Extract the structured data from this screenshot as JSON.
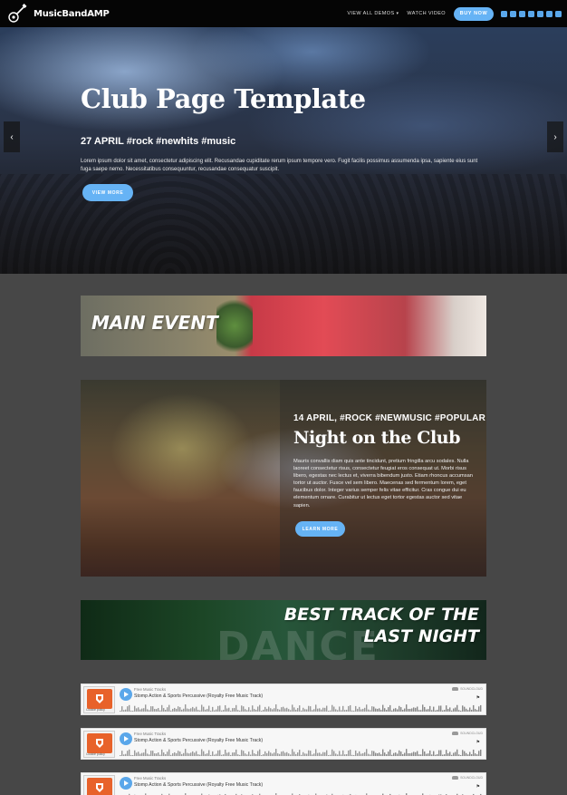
{
  "nav": {
    "brand": "MusicBandAMP",
    "demos_label": "VIEW ALL DEMOS",
    "video_label": "WATCH VIDEO",
    "buy_label": "BUY NOW"
  },
  "social_icons": [
    "youtube-icon",
    "facebook-icon",
    "pinterest-icon",
    "linkedin-icon",
    "vimeo-icon",
    "instagram-icon",
    "twitter-icon"
  ],
  "hero": {
    "title": "Club Page Template",
    "subtitle": "27 APRIL #rock #newhits #music",
    "text": "Lorem ipsum dolor sit amet, consectetur adipiscing elit. Recusandae cupiditate rerum ipsum tempore vero. Fugit facilis possimus assumenda ipsa, sapiente eius sunt fuga saepe nemo. Necessitatibus consequuntur, recusandae consequatur suscipit.",
    "button": "VIEW MORE",
    "prev": "‹",
    "next": "›"
  },
  "main_event": {
    "title": "MAIN EVENT"
  },
  "night": {
    "tags": "14 APRIL, #ROCK #NEWMUSIC #POPULAR",
    "title": "Night on the Club",
    "text": "Mauris convallis diam quis ante tincidunt, pretium fringilla arcu sodales. Nulla laoreet consectetur risus, consectetur feugiat eros consequat ut. Morbi risus libero, egestas nec lectus et, viverra bibendum justo. Etiam rhoncus accumsan tortor ut auctor. Fusce vel sem libero. Maecenas sed fermentum lorem, eget faucibus dolor. Integer varius semper felis vitae efficitur. Cras congue dui eu elementum ornare. Curabitur ut lectus eget tortor egestas auctor sed vitae sapien.",
    "button": "LEARN MORE"
  },
  "best_track": {
    "line1": "BEST TRACK OF THE",
    "line2": "LAST NIGHT",
    "bg_word": "DANCE"
  },
  "tracks": [
    {
      "artist": "Free Music Tracks",
      "title": "Stomp Action & Sports Percussive (Royalty Free Music Track)",
      "art_label": "Cookie policy",
      "source": "SOUNDCLOUD"
    },
    {
      "artist": "Free Music Tracks",
      "title": "Stomp Action & Sports Percussive (Royalty Free Music Track)",
      "art_label": "Cookie policy",
      "source": "SOUNDCLOUD"
    },
    {
      "artist": "Free Music Tracks",
      "title": "Stomp Action & Sports Percussive (Royalty Free Music Track)",
      "art_label": "Cookie policy",
      "source": "SOUNDCLOUD"
    }
  ],
  "colors": {
    "accent": "#66b3f5",
    "page_bg": "#474747",
    "nav_bg": "#050505",
    "soundcloud_art": "#e8622a"
  }
}
